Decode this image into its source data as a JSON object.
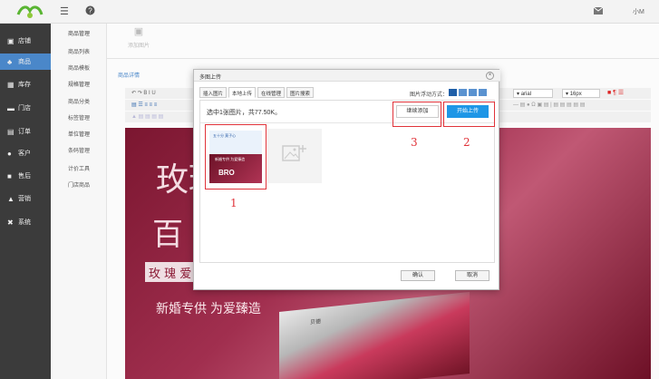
{
  "topbar": {
    "nav_icon": "list-icon",
    "help_icon": "help-icon",
    "mail_icon": "mail-icon",
    "user": "小M"
  },
  "sidebar": {
    "items": [
      {
        "label": "店铺",
        "icon": "store-icon"
      },
      {
        "label": "商品",
        "icon": "goods-icon"
      },
      {
        "label": "库存",
        "icon": "inventory-icon"
      },
      {
        "label": "门店",
        "icon": "shop-icon"
      },
      {
        "label": "订单",
        "icon": "order-icon"
      },
      {
        "label": "客户",
        "icon": "customer-icon"
      },
      {
        "label": "售后",
        "icon": "aftersale-icon"
      },
      {
        "label": "营销",
        "icon": "marketing-icon"
      },
      {
        "label": "系统",
        "icon": "settings-icon"
      }
    ]
  },
  "subnav": {
    "items": [
      "商品管理",
      "商品列表",
      "商品模板",
      "规格管理",
      "商品分类",
      "标签管理",
      "单位管理",
      "条码管理",
      "计价工具",
      "门店商品"
    ]
  },
  "main": {
    "add_image": "添加图片",
    "section_title": "商品详情",
    "font_family": "arial",
    "font_size": "16px"
  },
  "banner": {
    "line1": "玫瑰",
    "line2": "百",
    "line3": "玫 瑰 爱",
    "line4": "新婚专供 为爱臻造",
    "box_label": "贝德"
  },
  "dialog": {
    "title": "多图上传",
    "tabs": [
      "插入图片",
      "本地上传",
      "在线管理",
      "图片搜索"
    ],
    "float_label": "图片浮动方式：",
    "status": "选中1张图片，共77.50K。",
    "continue_label": "继续添加",
    "start_label": "开始上传",
    "ok_label": "确认",
    "cancel_label": "取消",
    "annotations": [
      "1",
      "2",
      "3"
    ],
    "thumb": {
      "line1": "五十分 莫子心",
      "line2": "新婚专供 为爱臻造",
      "line3": "BRO"
    },
    "accent": "#1e96e6",
    "annotation_color": "#e0333a"
  }
}
